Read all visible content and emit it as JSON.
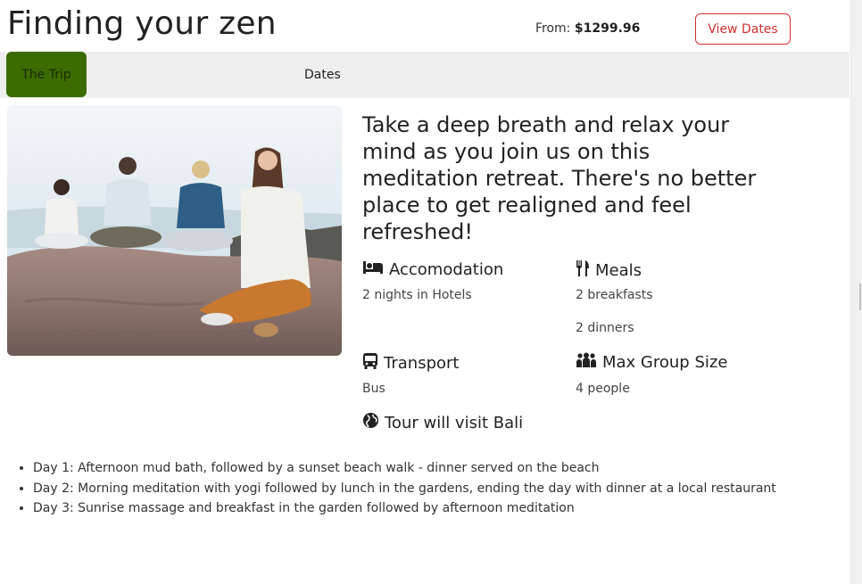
{
  "header": {
    "title": "Finding your zen",
    "price_prefix": "From:",
    "price_value": "$1299.96",
    "view_dates_label": "View Dates"
  },
  "tabs": [
    {
      "label": "The Trip",
      "active": true
    },
    {
      "label": "Dates",
      "active": false
    }
  ],
  "hero_image": {
    "alt": "Group meditating on rocks by the sea"
  },
  "lead_text": "Take a deep breath and relax your mind as you join us on this meditation retreat. There's no better place to get realigned and feel refreshed!",
  "features": {
    "accommodation": {
      "icon": "bed-icon",
      "title": "Accomodation",
      "items": [
        "2 nights in Hotels"
      ]
    },
    "meals": {
      "icon": "utensils-icon",
      "title": "Meals",
      "items": [
        "2 breakfasts",
        "2 dinners"
      ]
    },
    "transport": {
      "icon": "bus-icon",
      "title": "Transport",
      "items": [
        "Bus"
      ]
    },
    "group": {
      "icon": "people-group-icon",
      "title": "Max Group Size",
      "items": [
        "4 people"
      ]
    },
    "destination": {
      "icon": "globe-icon",
      "title": "Tour will visit Bali"
    }
  },
  "itinerary": [
    "Day 1: Afternoon mud bath, followed by a sunset beach walk - dinner served on the beach",
    "Day 2: Morning meditation with yogi followed by lunch in the gardens, ending the day with dinner at a local restaurant",
    "Day 3: Sunrise massage and breakfast in the garden followed by afternoon meditation"
  ],
  "colors": {
    "accent_red": "#d32f2f",
    "active_tab": "#3c6c00",
    "tabbar_bg": "#efefef"
  }
}
